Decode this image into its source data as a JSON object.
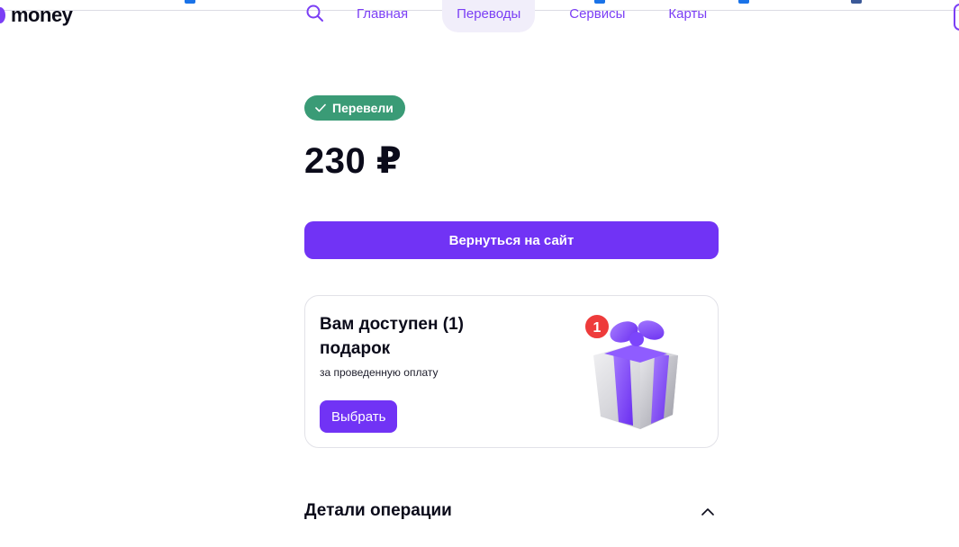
{
  "header": {
    "logo_text": "money",
    "nav": [
      {
        "label": "Главная",
        "active": false
      },
      {
        "label": "Переводы",
        "active": true
      },
      {
        "label": "Сервисы",
        "active": false
      },
      {
        "label": "Карты",
        "active": false
      }
    ]
  },
  "status": {
    "badge_label": "Перевели",
    "amount": "230 ₽"
  },
  "actions": {
    "return_label": "Вернуться на сайт"
  },
  "gift": {
    "title": "Вам доступен (1) подарок",
    "subtitle": "за проведенную оплату",
    "button_label": "Выбрать",
    "count": "1"
  },
  "details": {
    "title": "Детали операции"
  },
  "colors": {
    "accent": "#7133f5",
    "success": "#3a9b76",
    "text": "#0b0b1a"
  }
}
